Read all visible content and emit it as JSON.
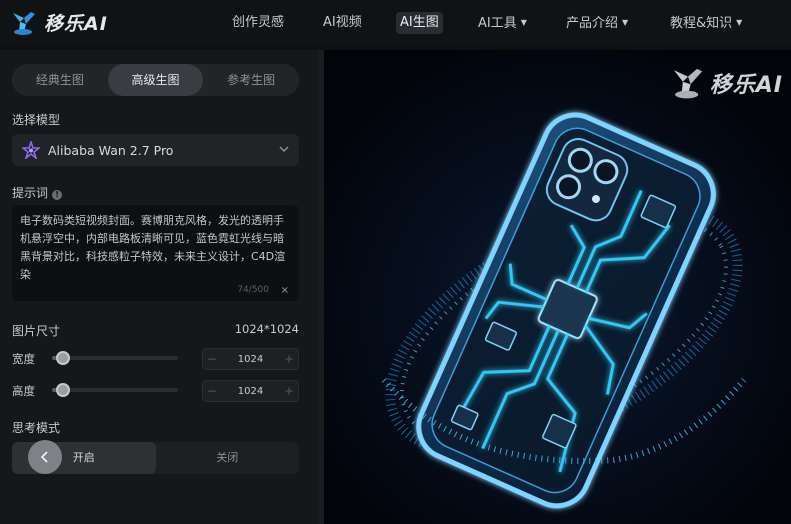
{
  "brand": {
    "name": "移乐AI"
  },
  "nav": {
    "items": [
      {
        "label": "创作灵感",
        "active": false,
        "has_caret": false
      },
      {
        "label": "AI视频",
        "active": false,
        "has_caret": false
      },
      {
        "label": "AI生图",
        "active": true,
        "has_caret": false
      },
      {
        "label": "AI工具",
        "active": false,
        "has_caret": true
      },
      {
        "label": "产品介绍",
        "active": false,
        "has_caret": true
      },
      {
        "label": "教程&知识",
        "active": false,
        "has_caret": true
      }
    ]
  },
  "panel": {
    "tabs": [
      {
        "label": "经典生图",
        "active": false
      },
      {
        "label": "高级生图",
        "active": true
      },
      {
        "label": "参考生图",
        "active": false
      }
    ],
    "model": {
      "label": "选择模型",
      "selected": "Alibaba Wan 2.7 Pro",
      "icon": "wan-model-icon"
    },
    "prompt": {
      "label": "提示词",
      "value": "电子数码类短视频封面。赛博朋克风格，发光的透明手机悬浮空中，内部电路板清晰可见，蓝色霓虹光线与暗黑背景对比，科技感粒子特效，未来主义设计，C4D渲染",
      "counter": "74/500",
      "clear_symbol": "×"
    },
    "image_size": {
      "label": "图片尺寸",
      "value": "1024*1024",
      "width": {
        "label": "宽度",
        "value": "1024",
        "level": 0.05
      },
      "height": {
        "label": "高度",
        "value": "1024",
        "level": 0.05
      },
      "minus": "−",
      "plus": "+"
    },
    "thinking_mode": {
      "label": "思考模式",
      "options": [
        {
          "label": "开启",
          "active": true
        },
        {
          "label": "关闭",
          "active": false
        }
      ]
    }
  },
  "preview": {
    "watermark": "移乐AI"
  },
  "colors": {
    "accent_glow": "#27b8ff",
    "background": "#0e0f11",
    "panel": "#16171a"
  }
}
